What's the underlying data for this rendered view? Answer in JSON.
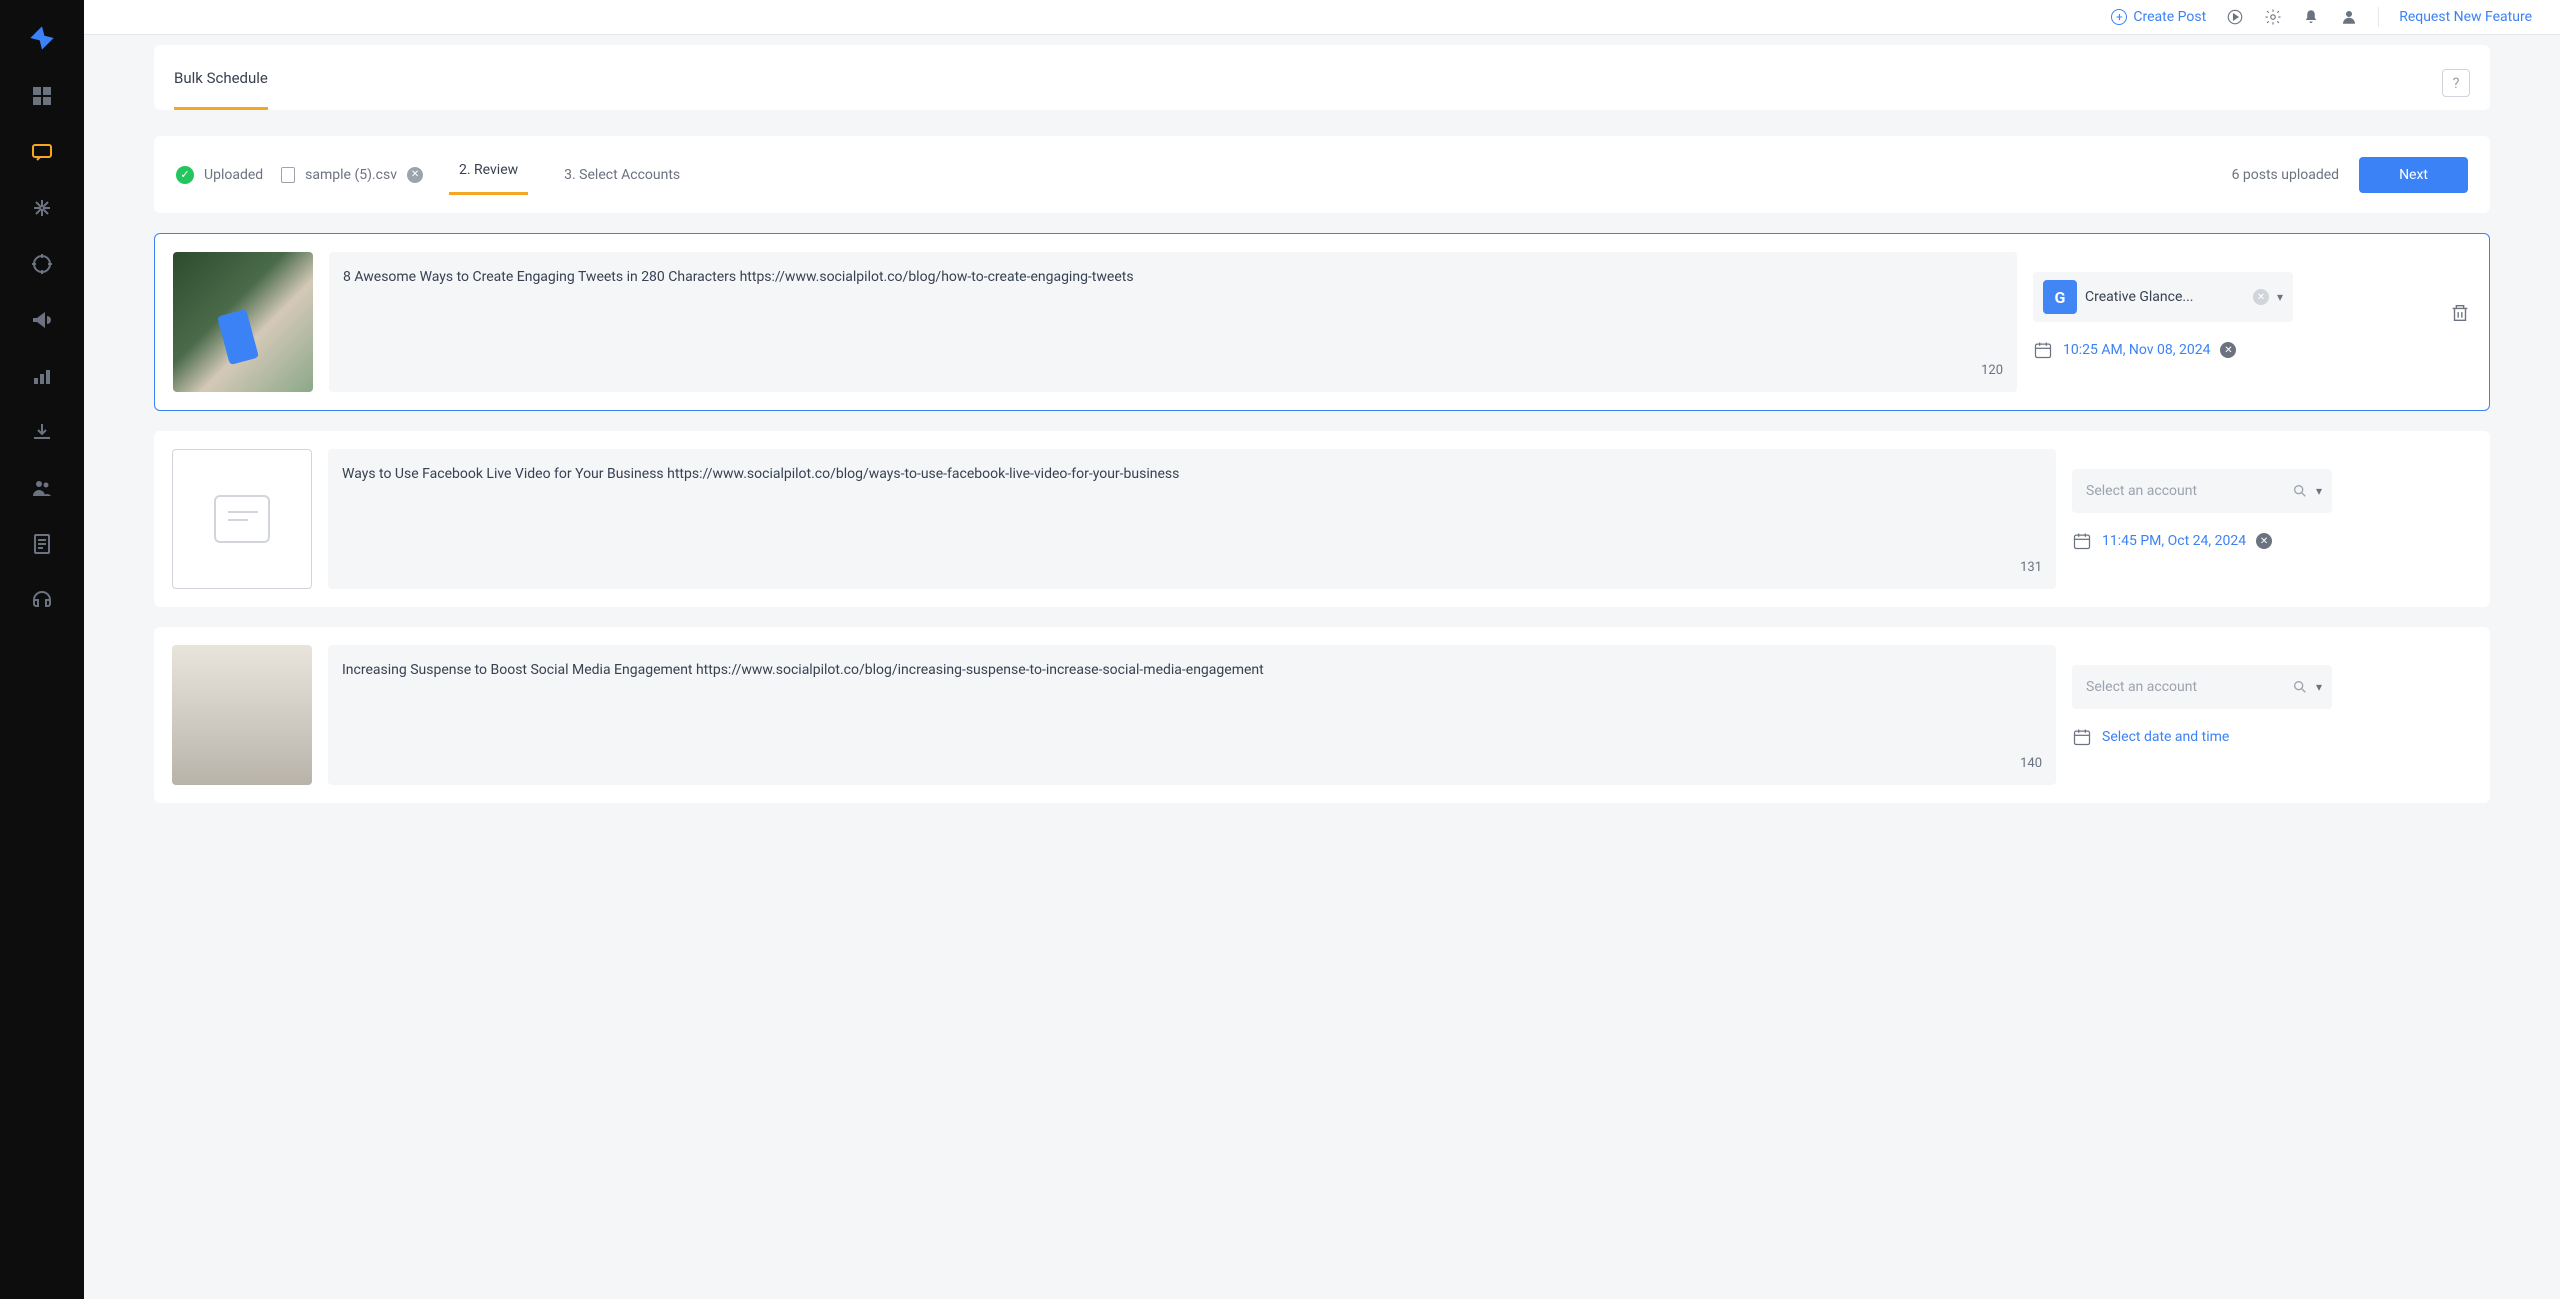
{
  "topbar": {
    "create_post": "Create Post",
    "request_feature": "Request New Feature"
  },
  "page": {
    "tab_title": "Bulk Schedule"
  },
  "steps": {
    "uploaded": "Uploaded",
    "file_name": "sample (5).csv",
    "review": "2. Review",
    "select_accounts": "3. Select Accounts",
    "count_text": "6  posts uploaded",
    "next": "Next"
  },
  "posts": [
    {
      "text": "8 Awesome Ways to Create Engaging Tweets in 280 Characters https://www.socialpilot.co/blog/how-to-create-engaging-tweets",
      "char_count": "120",
      "account": "Creative Glance...",
      "datetime": "10:25 AM, Nov 08, 2024"
    },
    {
      "text": "Ways to Use Facebook Live Video for Your Business https://www.socialpilot.co/blog/ways-to-use-facebook-live-video-for-your-business",
      "char_count": "131",
      "account_placeholder": "Select an account",
      "datetime": "11:45 PM, Oct 24, 2024"
    },
    {
      "text": "Increasing Suspense to Boost Social Media Engagement https://www.socialpilot.co/blog/increasing-suspense-to-increase-social-media-engagement",
      "char_count": "140",
      "account_placeholder": "Select an account",
      "datetime": "Select date and time"
    }
  ],
  "icons": {
    "google_badge": "G"
  }
}
